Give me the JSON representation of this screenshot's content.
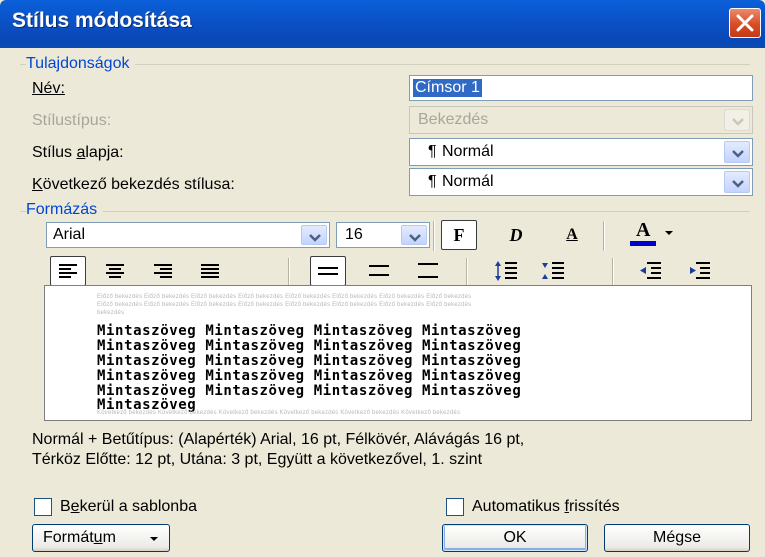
{
  "window": {
    "title": "Stílus módosítása"
  },
  "properties": {
    "group_label": "Tulajdonságok",
    "name_label": "Név:",
    "name_value": "Címsor 1",
    "type_label": "Stílustípus:",
    "type_value": "Bekezdés",
    "based_on_label": "Stílus alapja:",
    "based_on_value": "Normál",
    "next_label": "Következő bekezdés stílusa:",
    "next_value": "Normál",
    "paragraph_mark": "¶"
  },
  "formatting": {
    "group_label": "Formázás",
    "font": "Arial",
    "size": "16",
    "bold_glyph": "F",
    "italic_glyph": "D",
    "underline_glyph": "A",
    "font_color_glyph": "A",
    "font_color": "#0000cc"
  },
  "preview": {
    "ghost_before": [
      "Előző bekezdés Előző bekezdés Előző bekezdés Előző bekezdés Előző bekezdés Előző bekezdés Előző bekezdés Előző bekezdés",
      "Előző bekezdés Előző bekezdés Előző bekezdés Előző bekezdés Előző bekezdés Előző bekezdés Előző bekezdés Előző bekezdés",
      "bekezdés"
    ],
    "sample_lines": [
      "Mintaszöveg Mintaszöveg Mintaszöveg Mintaszöveg",
      "Mintaszöveg Mintaszöveg Mintaszöveg Mintaszöveg",
      "Mintaszöveg Mintaszöveg Mintaszöveg Mintaszöveg",
      "Mintaszöveg Mintaszöveg Mintaszöveg Mintaszöveg",
      "Mintaszöveg Mintaszöveg Mintaszöveg Mintaszöveg",
      "Mintaszöveg"
    ],
    "ghost_after": "Következő bekezdés Következő bekezdés Következő bekezdés Következő bekezdés Következő bekezdés Következő bekezdés"
  },
  "description": {
    "line1": "Normál + Betűtípus: (Alapérték) Arial, 16 pt, Félkövér, Alávágás 16 pt,",
    "line2": "Térköz Előtte:  12 pt, Utána:  3 pt, Együtt a következővel, 1. szint"
  },
  "options": {
    "add_to_template": "Bekerül a sablonba",
    "add_to_template_checked": false,
    "auto_update": "Automatikus frissítés",
    "auto_update_checked": false
  },
  "buttons": {
    "format": "Formátum",
    "ok": "OK",
    "cancel": "Mégse"
  }
}
